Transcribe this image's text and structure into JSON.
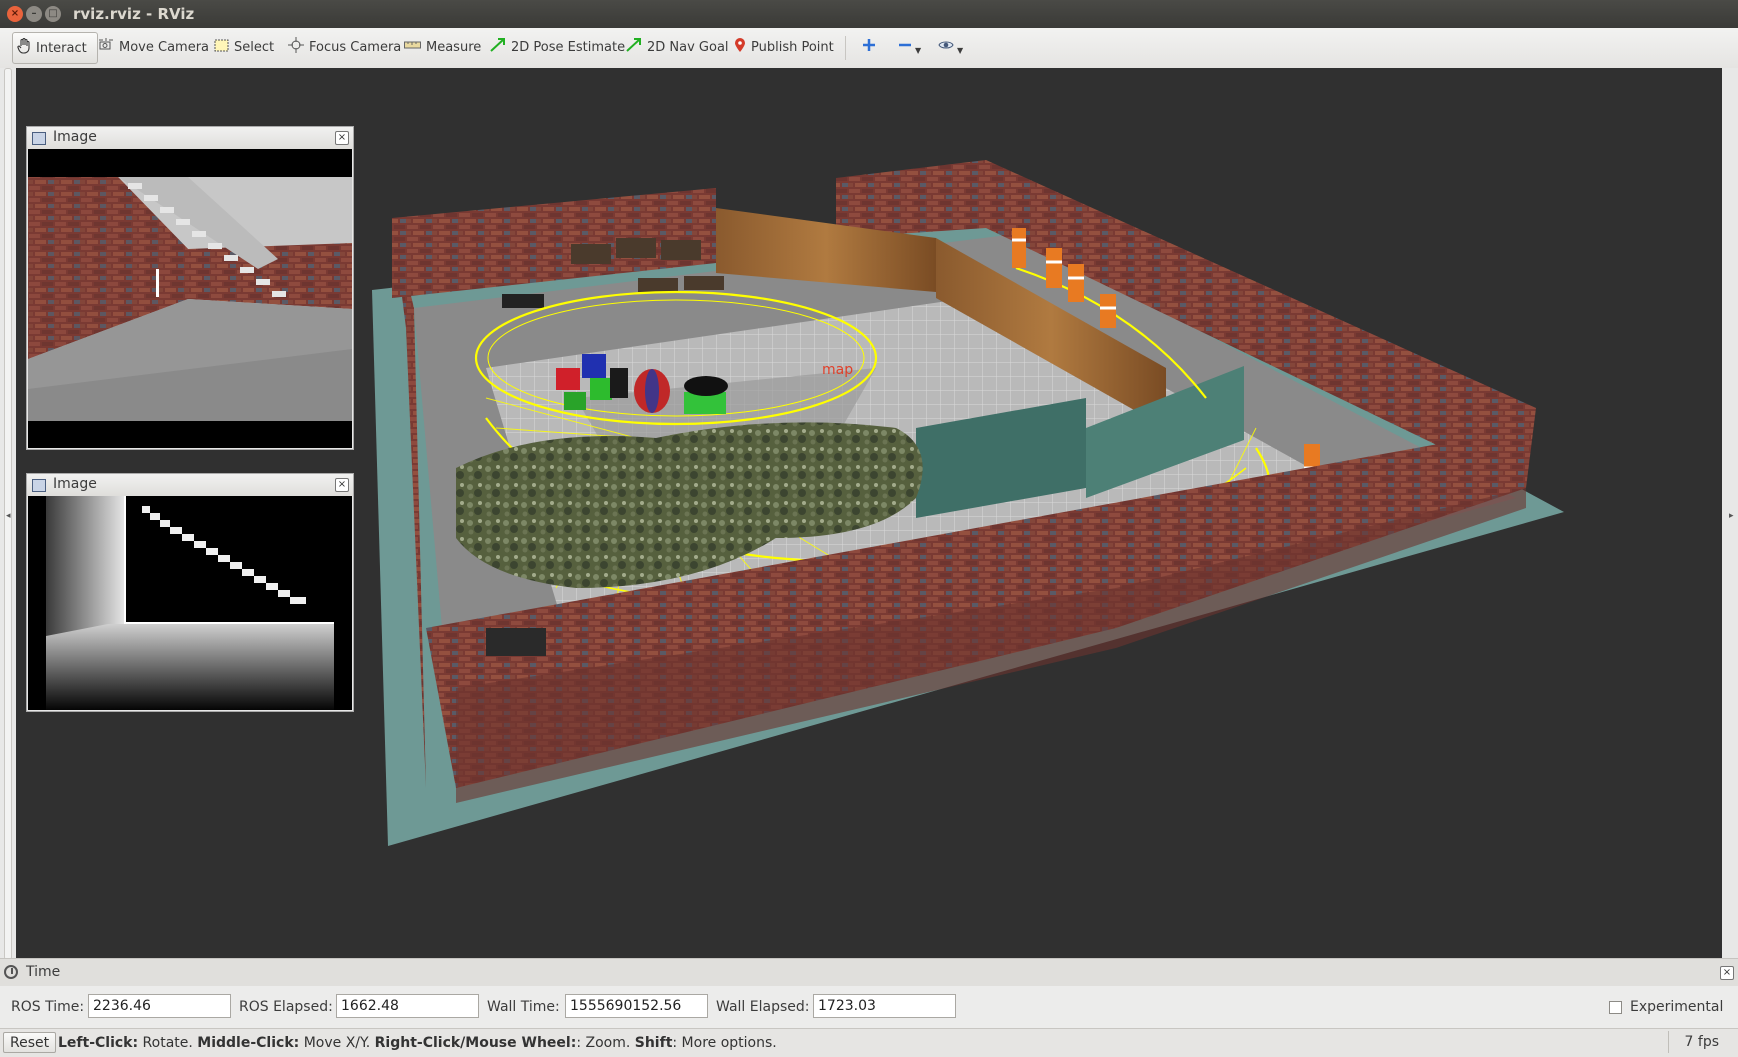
{
  "window": {
    "title": "rviz.rviz - RViz"
  },
  "toolbar": {
    "interact": "Interact",
    "move_camera": "Move Camera",
    "select": "Select",
    "focus_camera": "Focus Camera",
    "measure": "Measure",
    "pose_estimate": "2D Pose Estimate",
    "nav_goal": "2D Nav Goal",
    "publish_point": "Publish Point"
  },
  "image_panels": [
    {
      "title": "Image"
    },
    {
      "title": "Image"
    }
  ],
  "scene": {
    "robot_label": "map"
  },
  "time_panel": {
    "title": "Time",
    "ros_time_label": "ROS Time:",
    "ros_time": "2236.46",
    "ros_elapsed_label": "ROS Elapsed:",
    "ros_elapsed": "1662.48",
    "wall_time_label": "Wall Time:",
    "wall_time": "1555690152.56",
    "wall_elapsed_label": "Wall Elapsed:",
    "wall_elapsed": "1723.03",
    "experimental_label": "Experimental",
    "experimental_checked": false
  },
  "status": {
    "reset_label": "Reset",
    "hint_left": "Left-Click:",
    "hint_left_text": " Rotate. ",
    "hint_middle": "Middle-Click:",
    "hint_middle_text": " Move X/Y. ",
    "hint_right": "Right-Click/Mouse Wheel:",
    "hint_right_text": ": Zoom. ",
    "hint_shift": "Shift",
    "hint_shift_text": ": More options.",
    "fps": "7 fps"
  },
  "colors": {
    "viewport_bg": "#303030",
    "laser": "#ffff00",
    "ground": "#6e9995",
    "brick": "#7d3b34"
  }
}
